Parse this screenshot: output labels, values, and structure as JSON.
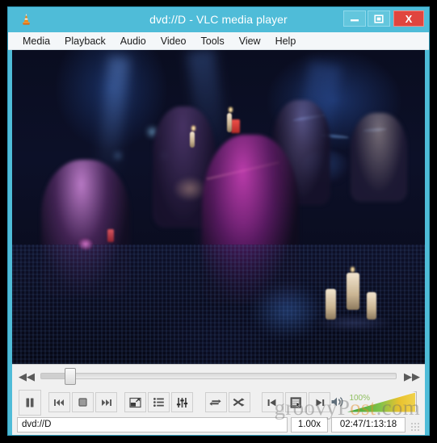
{
  "window": {
    "title": "dvd://D - VLC media player",
    "app_icon": "vlc-cone-icon",
    "controls": {
      "minimize": "minimize-icon",
      "maximize": "maximize-icon",
      "close": "X"
    }
  },
  "menubar": {
    "items": [
      {
        "label": "Media"
      },
      {
        "label": "Playback"
      },
      {
        "label": "Audio"
      },
      {
        "label": "Video"
      },
      {
        "label": "Tools"
      },
      {
        "label": "View"
      },
      {
        "label": "Help"
      }
    ]
  },
  "video": {
    "description": "Live concert stage with musicians under blue and purple lighting, candles on a table in the foreground"
  },
  "seek": {
    "jump_backward_icon": "rewind-icon",
    "jump_forward_icon": "fast-forward-icon",
    "position_percent": 8
  },
  "transport": {
    "play_pause": {
      "name": "pause-button",
      "state": "pause"
    },
    "previous": {
      "name": "previous-button"
    },
    "stop": {
      "name": "stop-button"
    },
    "next": {
      "name": "next-button"
    },
    "fullscreen": {
      "name": "fullscreen-button"
    },
    "playlist": {
      "name": "playlist-button"
    },
    "equalizer": {
      "name": "extended-settings-button"
    },
    "loop": {
      "name": "loop-button"
    },
    "shuffle": {
      "name": "shuffle-button"
    },
    "previous_chapter": {
      "name": "previous-chapter-button"
    },
    "dvd_menu": {
      "name": "dvd-menu-button"
    },
    "next_chapter": {
      "name": "next-chapter-button"
    }
  },
  "volume": {
    "icon": "speaker-icon",
    "label": "100%",
    "level_percent": 100,
    "accent_color": "#8fbf60"
  },
  "status": {
    "uri": "dvd://D",
    "rate": "1.00x",
    "time": "02:47/1:13:18"
  },
  "watermark": {
    "text_left": "groovyP",
    "text_accent": "ost",
    "text_right": ".com"
  },
  "colors": {
    "window_frame": "#4fbcd8",
    "close_button": "#e0453e",
    "panel": "#f0f0f0",
    "desktop": "#000000"
  }
}
